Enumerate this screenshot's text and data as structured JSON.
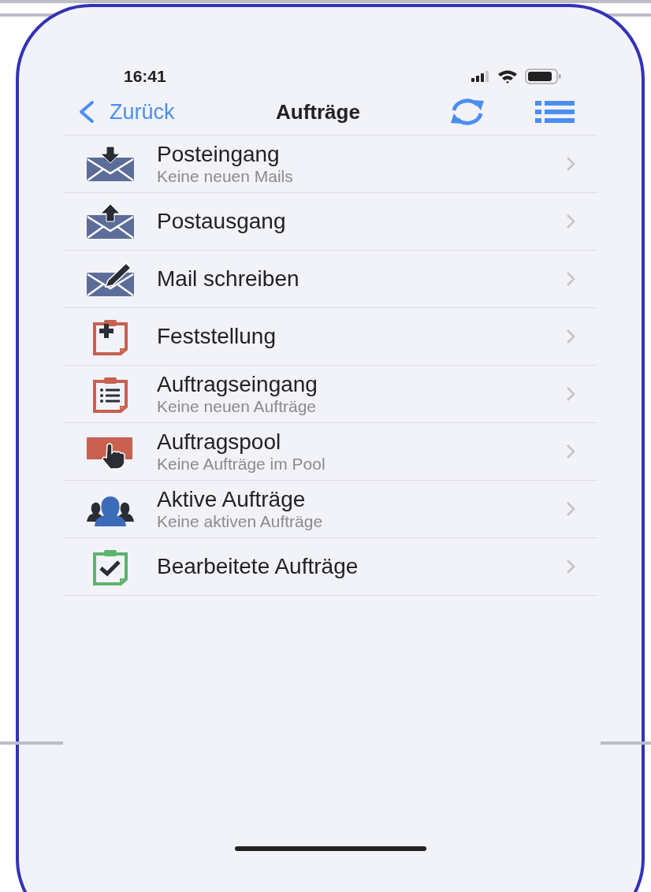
{
  "status_bar": {
    "time": "16:41"
  },
  "nav": {
    "back": "Zurück",
    "title": "Aufträge"
  },
  "items": [
    {
      "title": "Posteingang",
      "subtitle": "Keine neuen Mails"
    },
    {
      "title": "Postausgang"
    },
    {
      "title": "Mail schreiben"
    },
    {
      "title": "Feststellung"
    },
    {
      "title": "Auftragseingang",
      "subtitle": "Keine neuen Aufträge"
    },
    {
      "title": "Auftragspool",
      "subtitle": "Keine Aufträge im Pool"
    },
    {
      "title": "Aktive Aufträge",
      "subtitle": "Keine aktiven Aufträge"
    },
    {
      "title": "Bearbeitete Aufträge"
    }
  ]
}
